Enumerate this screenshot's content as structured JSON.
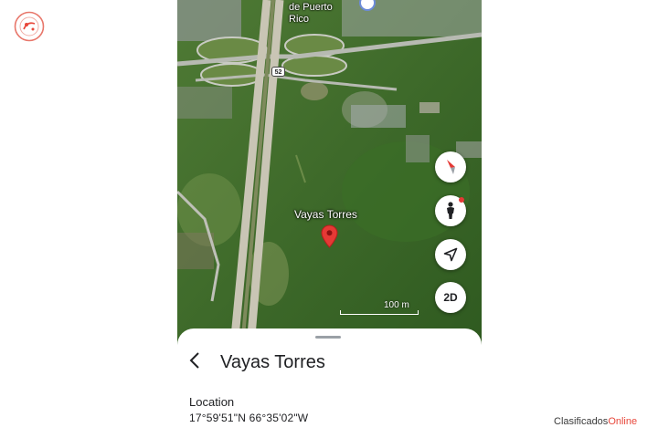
{
  "map": {
    "top_label_lines": [
      "de Puerto",
      "Rico"
    ],
    "route_shield": "52",
    "place_label": "Vayas Torres",
    "scale_label": "100 m"
  },
  "controls": {
    "compass_icon": "compass-icon",
    "pegman_icon": "pegman-icon",
    "location_icon": "navigation-arrow-icon",
    "view_toggle_label": "2D"
  },
  "sheet": {
    "title": "Vayas Torres",
    "section_heading": "Location",
    "coordinates": "17°59'51\"N 66°35'02\"W"
  },
  "watermark": {
    "part1": "Clasificados",
    "part2": "Online"
  },
  "colors": {
    "pin_red": "#e53935",
    "watermark_accent": "#e8473b"
  }
}
